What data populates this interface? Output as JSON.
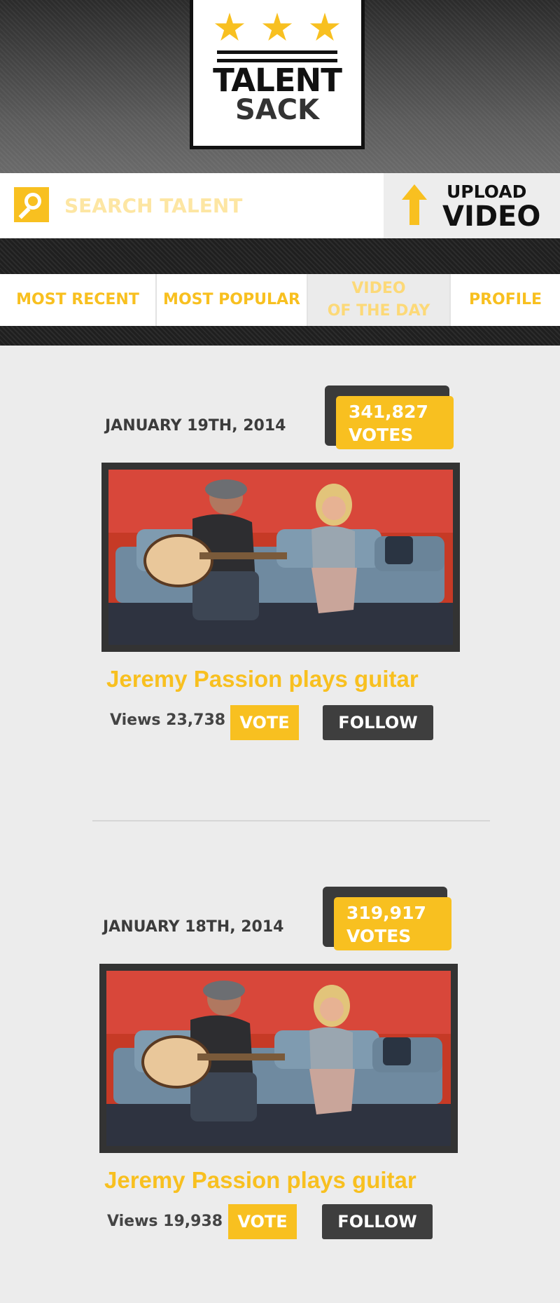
{
  "brand": {
    "logo_line1": "TALENT",
    "logo_line2": "SACK",
    "star_color": "#f8c020"
  },
  "search": {
    "placeholder": "SEARCH TALENT",
    "icon": "magnifier-icon"
  },
  "upload": {
    "line1": "UPLOAD",
    "line2": "VIDEO",
    "icon": "up-arrow-icon"
  },
  "tabs": [
    {
      "label": "MOST RECENT",
      "active": false
    },
    {
      "label": "MOST POPULAR",
      "active": false
    },
    {
      "label": "VIDEO\nOF THE DAY",
      "active": true
    },
    {
      "label": "PROFILE",
      "active": false
    }
  ],
  "feed": [
    {
      "date": "JANUARY 19TH, 2014",
      "votes_count": "341,827",
      "votes_label": "VOTES",
      "title": "Jeremy Passion plays guitar",
      "views": "Views 23,738",
      "vote_label": "VOTE",
      "follow_label": "FOLLOW"
    },
    {
      "date": "JANUARY 18TH, 2014",
      "votes_count": "319,917",
      "votes_label": "VOTES",
      "title": "Jeremy Passion plays guitar",
      "views": "Views 19,938",
      "vote_label": "VOTE",
      "follow_label": "FOLLOW"
    }
  ],
  "colors": {
    "accent": "#f8c020",
    "dark": "#3e3e3e",
    "background": "#ececec"
  }
}
